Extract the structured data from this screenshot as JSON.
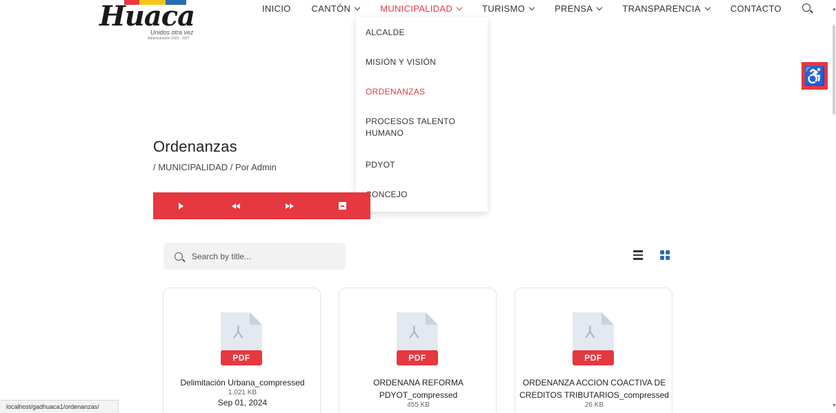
{
  "logo": {
    "word": "Huaca",
    "tagline": "Unidos otra vez",
    "admin_period": "Administración 2023 - 2027",
    "stripe_colors": [
      "#e53840",
      "#f5c518",
      "#2b6cb0"
    ]
  },
  "nav": {
    "items": [
      {
        "label": "INICIO",
        "has_submenu": false
      },
      {
        "label": "CANTÓN",
        "has_submenu": true
      },
      {
        "label": "MUNICIPALIDAD",
        "has_submenu": true,
        "active": true
      },
      {
        "label": "TURISMO",
        "has_submenu": true
      },
      {
        "label": "PRENSA",
        "has_submenu": true
      },
      {
        "label": "TRANSPARENCIA",
        "has_submenu": true
      },
      {
        "label": "CONTACTO",
        "has_submenu": false
      }
    ]
  },
  "dropdown": {
    "items": [
      {
        "label": "ALCALDE"
      },
      {
        "label": "MISIÓN Y VISIÓN"
      },
      {
        "label": "ORDENANZAS",
        "active": true
      },
      {
        "label": "PROCESOS TALENTO HUMANO"
      },
      {
        "label": "PDYOT"
      },
      {
        "label": "CONCEJO"
      }
    ]
  },
  "page": {
    "title": "Ordenanzas",
    "breadcrumb": "/ MUNICIPALIDAD / Por Admin"
  },
  "search": {
    "placeholder": "Search by title..."
  },
  "documents": [
    {
      "type_label": "PDF",
      "title": "Delimitación Urbana_compressed",
      "size": "1.021 KB",
      "date": "Sep 01, 2024"
    },
    {
      "type_label": "PDF",
      "title": "ORDENANA REFORMA PDYOT_compressed",
      "size": "455 KB",
      "date": ""
    },
    {
      "type_label": "PDF",
      "title": "ORDENANZA ACCION COACTIVA DE CREDITOS TRIBUTARIOS_compressed",
      "size": "26 KB",
      "date": ""
    }
  ],
  "status_bar": {
    "url": "localhost/gadhuaca1/ordenanzas/"
  },
  "colors": {
    "accent": "#e53840",
    "grid_icon": "#2b6cb0"
  },
  "icons": {
    "accessibility": "wheelchair-icon",
    "play": "play-icon",
    "rewind": "rewind-icon",
    "fast_forward": "fast-forward-icon",
    "fullscreen": "fullscreen-icon",
    "search": "search-icon",
    "list_view": "list-view-icon",
    "grid_view": "grid-view-icon"
  }
}
